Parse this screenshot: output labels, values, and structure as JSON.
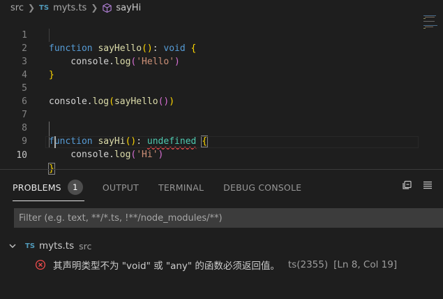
{
  "breadcrumb": {
    "folder": "src",
    "file_badge": "TS",
    "file": "myts.ts",
    "symbol": "sayHi"
  },
  "editor": {
    "lines": [
      {
        "n": "1",
        "text": "function sayHello(): void {"
      },
      {
        "n": "2",
        "text": "    console.log('Hello')"
      },
      {
        "n": "3",
        "text": "}"
      },
      {
        "n": "4",
        "text": ""
      },
      {
        "n": "5",
        "text": "console.log(sayHello())"
      },
      {
        "n": "6",
        "text": ""
      },
      {
        "n": "7",
        "text": ""
      },
      {
        "n": "8",
        "text": "function sayHi(): undefined {"
      },
      {
        "n": "9",
        "text": "    console.log('Hi')"
      },
      {
        "n": "10",
        "text": "}"
      }
    ],
    "active_line": "10"
  },
  "panel": {
    "tabs": [
      {
        "label": "PROBLEMS",
        "badge": "1",
        "active": true
      },
      {
        "label": "OUTPUT"
      },
      {
        "label": "TERMINAL"
      },
      {
        "label": "DEBUG CONSOLE"
      }
    ],
    "filter_placeholder": "Filter (e.g. text, **/*.ts, !**/node_modules/**)",
    "file_group": {
      "badge": "TS",
      "name": "myts.ts",
      "dir": "src"
    },
    "problem": {
      "message": "其声明类型不为 \"void\" 或 \"any\" 的函数必须返回值。",
      "code": "ts(2355)",
      "position": "[Ln 8, Col 19]"
    }
  },
  "colors": {
    "background": "#1e1e1e",
    "keyword": "#569cd6",
    "function": "#dcdcaa",
    "string": "#ce9178",
    "type": "#4ec9b0",
    "error": "#f14c4c",
    "ts_badge": "#519aba"
  }
}
